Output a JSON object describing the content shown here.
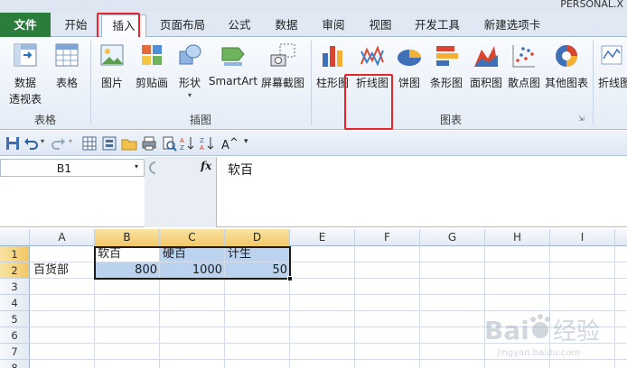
{
  "window": {
    "title_fragment": "PERSONAL.X"
  },
  "tabs": [
    {
      "label": "文件",
      "kind": "file"
    },
    {
      "label": "开始"
    },
    {
      "label": "插入",
      "active": true
    },
    {
      "label": "页面布局"
    },
    {
      "label": "公式"
    },
    {
      "label": "数据"
    },
    {
      "label": "审阅"
    },
    {
      "label": "视图"
    },
    {
      "label": "开发工具"
    },
    {
      "label": "新建选项卡"
    }
  ],
  "ribbon": {
    "groups": {
      "table": "表格",
      "illustration": "插图",
      "chart": "图表"
    },
    "buttons": {
      "pivot_line1": "数据",
      "pivot_line2": "透视表",
      "table": "表格",
      "picture": "图片",
      "clipart": "剪贴画",
      "shapes": "形状",
      "smartart": "SmartArt",
      "screenshot": "屏幕截图",
      "column": "柱形图",
      "line": "折线图",
      "pie": "饼图",
      "bar": "条形图",
      "area": "面积图",
      "scatter": "散点图",
      "other": "其他图表",
      "line_partial": "折线图"
    }
  },
  "namebox": {
    "value": "B1"
  },
  "formula": {
    "fx": "fx",
    "value": "软百"
  },
  "columns": [
    "A",
    "B",
    "C",
    "D",
    "E",
    "F",
    "G",
    "H",
    "I"
  ],
  "rows": [
    "1",
    "2",
    "3",
    "4",
    "5",
    "6",
    "7",
    "8"
  ],
  "cells": {
    "A2": "百货部",
    "B1": "软百",
    "C1": "硬百",
    "D1": "计生",
    "B2": "800",
    "C2": "1000",
    "D2": "50"
  },
  "watermark": {
    "text": "Bai经验",
    "subtext": "jingyan.baidu.com"
  },
  "colors": {
    "file_tab": "#2a7d3b",
    "highlight_box": "#e8262a",
    "selection_fill": "#bcd3ef",
    "header_selected": "#f2c766"
  }
}
